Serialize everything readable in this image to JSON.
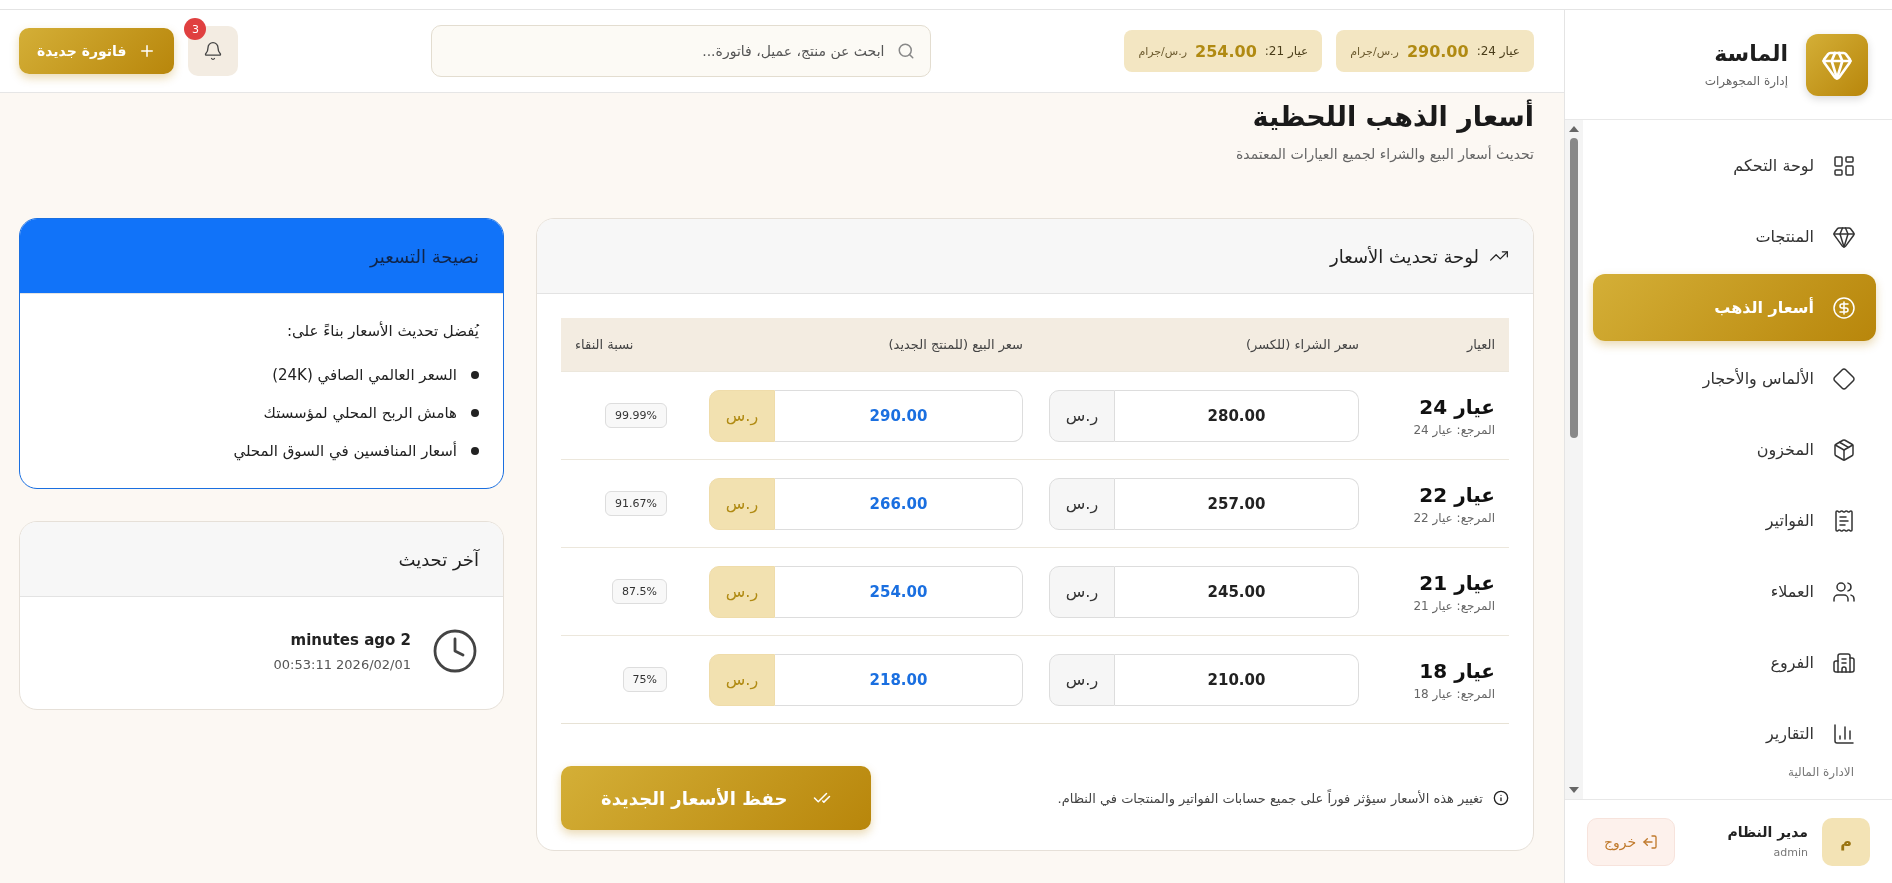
{
  "sidebar": {
    "brand": {
      "name": "الماسة",
      "tagline": "إدارة المجوهرات"
    },
    "items": [
      {
        "label": "لوحة التحكم",
        "selected": false
      },
      {
        "label": "المنتجات",
        "selected": false
      },
      {
        "label": "أسعار الذهب",
        "selected": true
      },
      {
        "label": "الألماس والأحجار",
        "selected": false
      },
      {
        "label": "المخزون",
        "selected": false
      },
      {
        "label": "الفواتير",
        "selected": false
      },
      {
        "label": "العملاء",
        "selected": false
      },
      {
        "label": "الفروع",
        "selected": false
      },
      {
        "label": "التقارير",
        "selected": false
      }
    ],
    "section_label": "الادارة المالية",
    "user": {
      "initial": "م",
      "name": "مدير النظام",
      "role": "admin",
      "logout": "خروج"
    }
  },
  "topbar": {
    "price_chips": [
      {
        "label": "عيار 24:",
        "value": "290.00",
        "unit": "ر.س/جرام"
      },
      {
        "label": "عيار 21:",
        "value": "254.00",
        "unit": "ر.س/جرام"
      }
    ],
    "search": {
      "placeholder": "ابحث عن منتج، عميل، فاتورة..."
    },
    "notifications": {
      "count": "3"
    },
    "new_invoice": "فاتورة جديدة"
  },
  "page": {
    "title": "أسعار الذهب اللحظية",
    "subtitle": "تحديث أسعار البيع والشراء لجميع العيارات المعتمدة"
  },
  "prices_card": {
    "title": "لوحة تحديث الأسعار",
    "columns": [
      "العيار",
      "سعر الشراء (للكسر)",
      "سعر البيع (للمنتج الجديد)",
      "نسبة النقاء"
    ],
    "rows": [
      {
        "karat": "عيار 24",
        "reference": "المرجع: عيار 24",
        "buy": "280.00",
        "buy_currency": "ر.س",
        "sell": "290.00",
        "sell_currency": "ر.س",
        "purity": "99.99%"
      },
      {
        "karat": "عيار 22",
        "reference": "المرجع: عيار 22",
        "buy": "257.00",
        "buy_currency": "ر.س",
        "sell": "266.00",
        "sell_currency": "ر.س",
        "purity": "91.67%"
      },
      {
        "karat": "عيار 21",
        "reference": "المرجع: عيار 21",
        "buy": "245.00",
        "buy_currency": "ر.س",
        "sell": "254.00",
        "sell_currency": "ر.س",
        "purity": "87.5%"
      },
      {
        "karat": "عيار 18",
        "reference": "المرجع: عيار 18",
        "buy": "210.00",
        "buy_currency": "ر.س",
        "sell": "218.00",
        "sell_currency": "ر.س",
        "purity": "75%"
      }
    ],
    "note": "تغيير هذه الأسعار سيؤثر فوراً على جميع حسابات الفواتير والمنتجات في النظام.",
    "save_button": "حفظ الأسعار الجديدة"
  },
  "tip_card": {
    "title": "نصيحة التسعير",
    "intro": "يُفضل تحديث الأسعار بناءً على:",
    "points": [
      "السعر العالمي الصافي (24K)",
      "هامش الربح المحلي لمؤسستك",
      "أسعار المنافسين في السوق المحلي"
    ]
  },
  "last_update_card": {
    "title": "آخر تحديث",
    "relative": "minutes ago 2",
    "timestamp": "00:53:11 2026/02/01"
  }
}
